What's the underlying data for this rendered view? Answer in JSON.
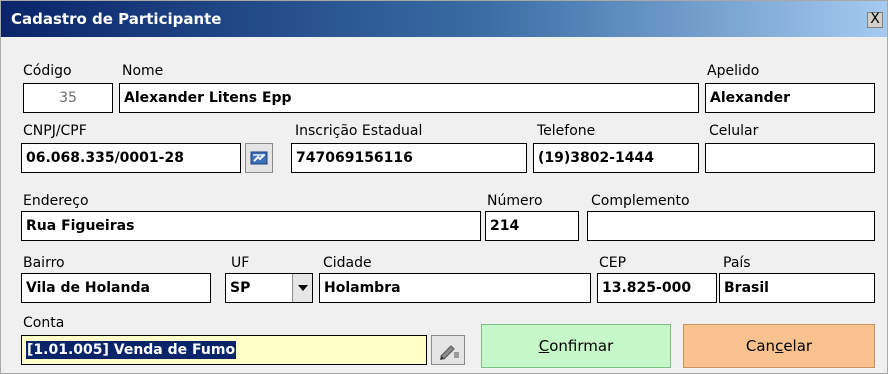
{
  "window": {
    "title": "Cadastro de Participante",
    "close_label": "X"
  },
  "labels": {
    "codigo": "Código",
    "nome": "Nome",
    "apelido": "Apelido",
    "cnpj": "CNPJ/CPF",
    "ie": "Inscrição Estadual",
    "telefone": "Telefone",
    "celular": "Celular",
    "endereco": "Endereço",
    "numero": "Número",
    "complemento": "Complemento",
    "bairro": "Bairro",
    "uf": "UF",
    "cidade": "Cidade",
    "cep": "CEP",
    "pais": "País",
    "conta": "Conta"
  },
  "fields": {
    "codigo": "35",
    "nome": "Alexander Litens Epp",
    "apelido": "Alexander",
    "cnpj": "06.068.335/0001-28",
    "ie": "747069156116",
    "telefone": "(19)3802-1444",
    "celular": "",
    "endereco": "Rua Figueiras",
    "numero": "214",
    "complemento": "",
    "bairro": "Vila de Holanda",
    "uf": "SP",
    "cidade": "Holambra",
    "cep": "13.825-000",
    "pais": "Brasil",
    "conta": "[1.01.005] Venda de Fumo"
  },
  "buttons": {
    "confirm_pre": "",
    "confirm_u": "C",
    "confirm_post": "onfirmar",
    "cancel_pre": "Can",
    "cancel_u": "c",
    "cancel_post": "elar"
  },
  "icons": {
    "cnpj_lookup": "lookup-card-icon",
    "conta_edit": "edit-pencil-icon",
    "uf_dropdown": "chevron-down-icon"
  }
}
